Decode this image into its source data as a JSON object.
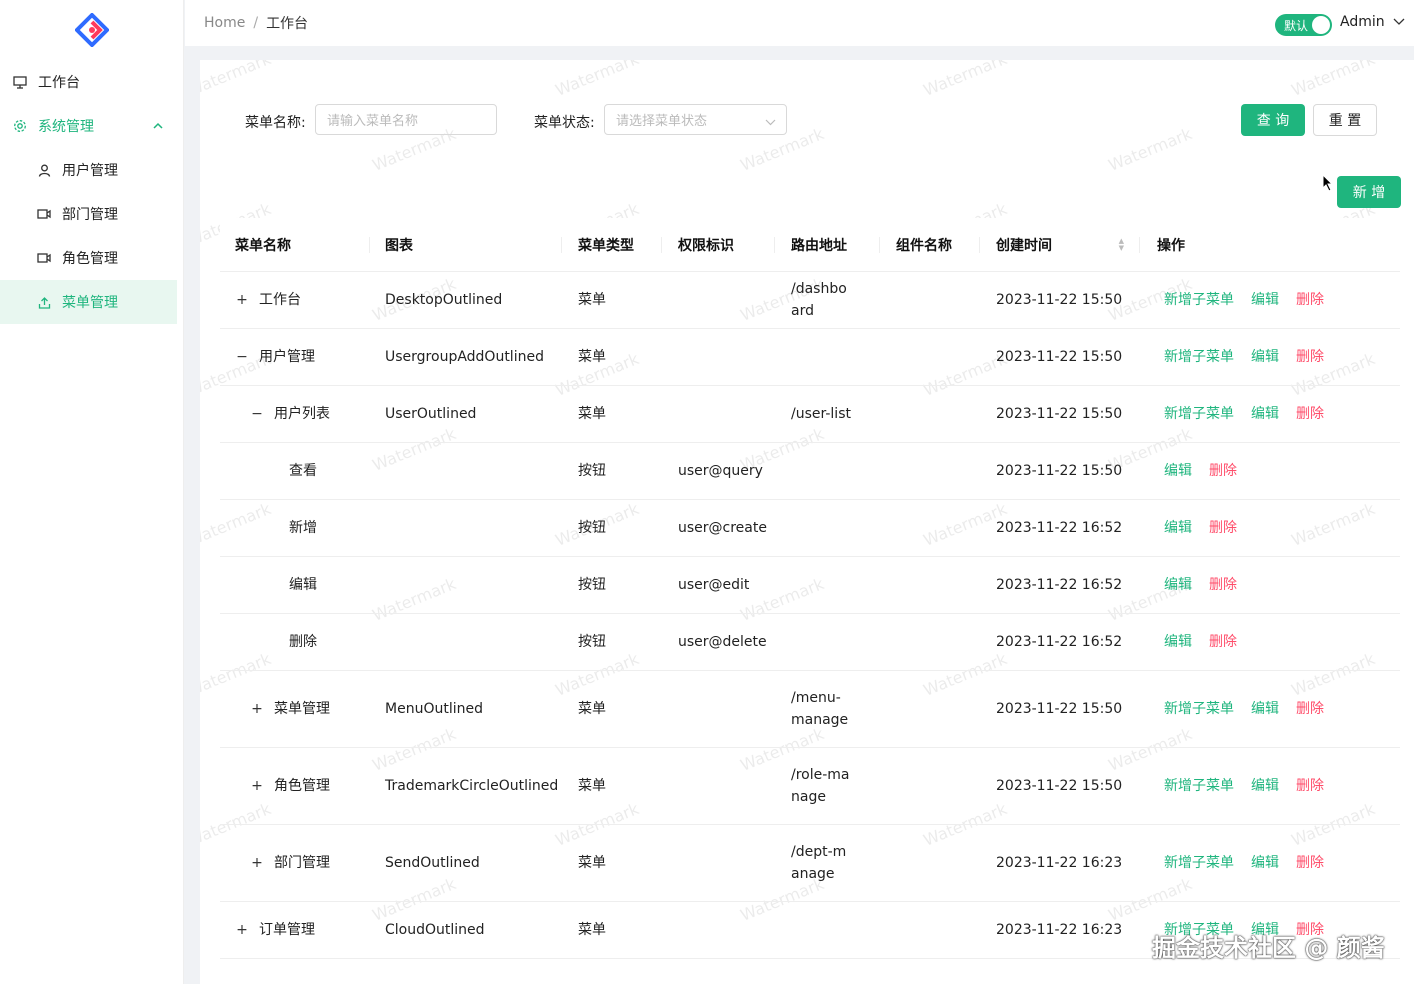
{
  "sidebar": {
    "items": [
      {
        "label": "工作台"
      },
      {
        "label": "系统管理"
      },
      {
        "label": "用户管理"
      },
      {
        "label": "部门管理"
      },
      {
        "label": "角色管理"
      },
      {
        "label": "菜单管理"
      }
    ]
  },
  "header": {
    "breadcrumb_home": "Home",
    "breadcrumb_sep": "/",
    "breadcrumb_current": "工作台",
    "toggle_label": "默认",
    "user": "Admin"
  },
  "search": {
    "name_label": "菜单名称:",
    "name_placeholder": "请输入菜单名称",
    "status_label": "菜单状态:",
    "status_placeholder": "请选择菜单状态",
    "query_label": "查 询",
    "reset_label": "重 置",
    "add_label": "新 增"
  },
  "table": {
    "columns": [
      "菜单名称",
      "图表",
      "菜单类型",
      "权限标识",
      "路由地址",
      "组件名称",
      "创建时间",
      "操作"
    ],
    "rows": [
      {
        "expander": "+",
        "name": "工作台",
        "icon": "DesktopOutlined",
        "type": "菜单",
        "perm": "",
        "route": "/dashboard",
        "comp": "",
        "time": "2023-11-22 15:50",
        "ops": [
          "新增子菜单",
          "编辑",
          "删除"
        ]
      },
      {
        "expander": "−",
        "name": "用户管理",
        "icon": "UsergroupAddOutlined",
        "type": "菜单",
        "perm": "",
        "route": "",
        "comp": "",
        "time": "2023-11-22 15:50",
        "ops": [
          "新增子菜单",
          "编辑",
          "删除"
        ]
      },
      {
        "expander": "−",
        "name": "用户列表",
        "icon": "UserOutlined",
        "type": "菜单",
        "perm": "",
        "route": "/user-list",
        "comp": "",
        "time": "2023-11-22 15:50",
        "ops": [
          "新增子菜单",
          "编辑",
          "删除"
        ]
      },
      {
        "expander": "",
        "name": "查看",
        "icon": "",
        "type": "按钮",
        "perm": "user@query",
        "route": "",
        "comp": "",
        "time": "2023-11-22 15:50",
        "ops": [
          "编辑",
          "删除"
        ]
      },
      {
        "expander": "",
        "name": "新增",
        "icon": "",
        "type": "按钮",
        "perm": "user@create",
        "route": "",
        "comp": "",
        "time": "2023-11-22 16:52",
        "ops": [
          "编辑",
          "删除"
        ]
      },
      {
        "expander": "",
        "name": "编辑",
        "icon": "",
        "type": "按钮",
        "perm": "user@edit",
        "route": "",
        "comp": "",
        "time": "2023-11-22 16:52",
        "ops": [
          "编辑",
          "删除"
        ]
      },
      {
        "expander": "",
        "name": "删除",
        "icon": "",
        "type": "按钮",
        "perm": "user@delete",
        "route": "",
        "comp": "",
        "time": "2023-11-22 16:52",
        "ops": [
          "编辑",
          "删除"
        ]
      },
      {
        "expander": "+",
        "name": "菜单管理",
        "icon": "MenuOutlined",
        "type": "菜单",
        "perm": "",
        "route": "/menu-manage",
        "comp": "",
        "time": "2023-11-22 15:50",
        "ops": [
          "新增子菜单",
          "编辑",
          "删除"
        ]
      },
      {
        "expander": "+",
        "name": "角色管理",
        "icon": "TrademarkCircleOutlined",
        "type": "菜单",
        "perm": "",
        "route": "/role-manage",
        "comp": "",
        "time": "2023-11-22 15:50",
        "ops": [
          "新增子菜单",
          "编辑",
          "删除"
        ]
      },
      {
        "expander": "+",
        "name": "部门管理",
        "icon": "SendOutlined",
        "type": "菜单",
        "perm": "",
        "route": "/dept-manage",
        "comp": "",
        "time": "2023-11-22 16:23",
        "ops": [
          "新增子菜单",
          "编辑",
          "删除"
        ]
      },
      {
        "expander": "+",
        "name": "订单管理",
        "icon": "CloudOutlined",
        "type": "菜单",
        "perm": "",
        "route": "",
        "comp": "",
        "time": "2023-11-22 16:23",
        "ops": [
          "新增子菜单",
          "编辑",
          "删除"
        ]
      }
    ]
  },
  "watermark": "Watermark",
  "signature": "掘金技术社区 @ 颜酱",
  "colors": {
    "accent": "#1fb57e",
    "danger": "#ff4d6a"
  }
}
